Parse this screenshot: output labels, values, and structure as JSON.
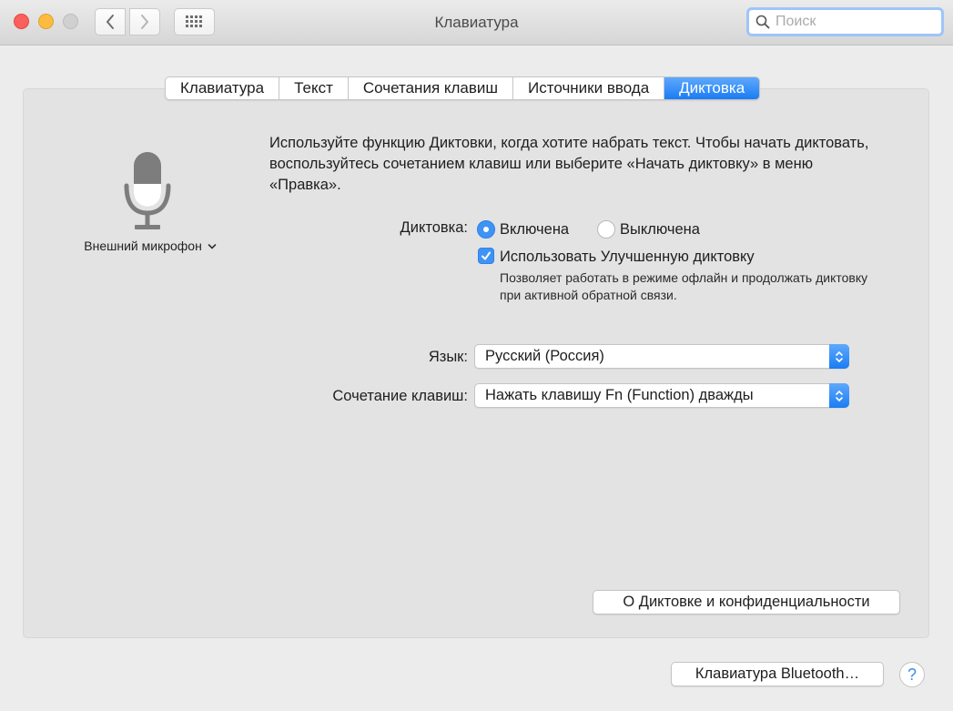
{
  "window": {
    "title": "Клавиатура"
  },
  "search": {
    "placeholder": "Поиск",
    "value": ""
  },
  "tabs": [
    {
      "label": "Клавиатура",
      "active": false
    },
    {
      "label": "Текст",
      "active": false
    },
    {
      "label": "Сочетания клавиш",
      "active": false
    },
    {
      "label": "Источники ввода",
      "active": false
    },
    {
      "label": "Диктовка",
      "active": true
    }
  ],
  "mic": {
    "source_label": "Внешний микрофон"
  },
  "description": "Используйте функцию Диктовки, когда хотите набрать текст. Чтобы начать диктовать, воспользуйтесь сочетанием клавиш или выберите «Начать диктовку» в меню «Правка».",
  "dictation": {
    "label": "Диктовка:",
    "on_label": "Включена",
    "off_label": "Выключена",
    "selected": "on"
  },
  "enhanced": {
    "checked": true,
    "label": "Использовать Улучшенную диктовку",
    "note": "Позволяет работать в режиме офлайн и продолжать диктовку при активной обратной связи."
  },
  "language": {
    "label": "Язык:",
    "value": "Русский (Россия)"
  },
  "shortcut": {
    "label": "Сочетание клавиш:",
    "value": "Нажать клавишу Fn (Function) дважды"
  },
  "buttons": {
    "privacy": "О Диктовке и конфиденциальности",
    "bluetooth": "Клавиатура Bluetooth…",
    "help": "?"
  },
  "colors": {
    "accent": "#3e93f5",
    "close": "#fc605c",
    "minimize": "#fdbc40"
  }
}
